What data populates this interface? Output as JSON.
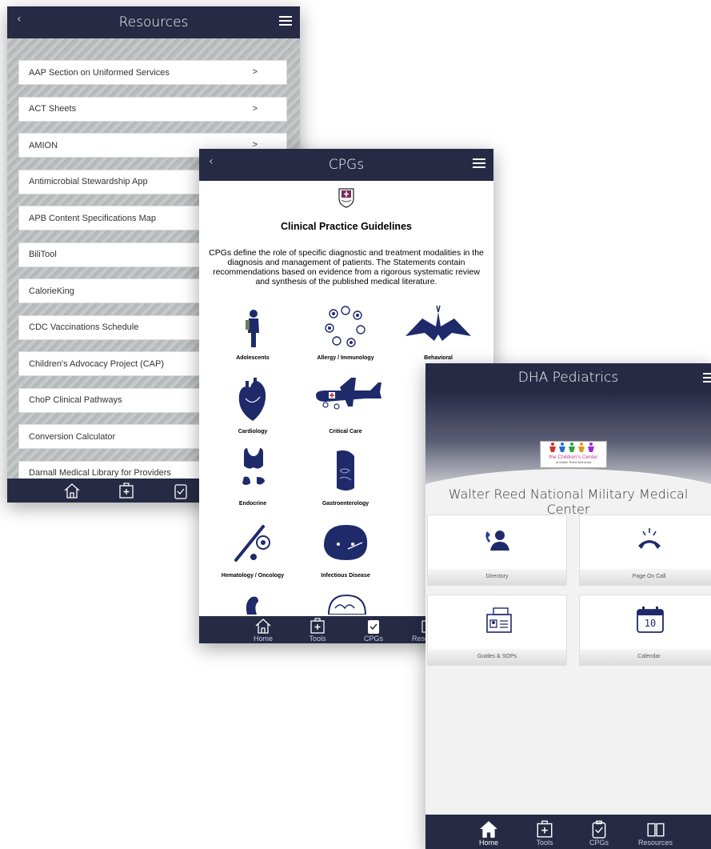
{
  "resources": {
    "title": "Resources",
    "back": "‹",
    "items": [
      {
        "label": "AAP Section on Uniformed Services",
        "chevron": ">"
      },
      {
        "label": "ACT Sheets",
        "chevron": ">"
      },
      {
        "label": "AMION",
        "chevron": ">"
      },
      {
        "label": "Antimicrobial Stewardship App"
      },
      {
        "label": "APB Content Specifications Map"
      },
      {
        "label": "BiliTool"
      },
      {
        "label": "CalorieKing"
      },
      {
        "label": "CDC Vaccinations Schedule"
      },
      {
        "label": "Children's Advocacy Project (CAP)"
      },
      {
        "label": "ChoP Clinical Pathways"
      },
      {
        "label": "Conversion Calculator"
      },
      {
        "label": "Darnall Medical Library for Providers"
      }
    ]
  },
  "cpgs": {
    "title": "CPGs",
    "back": "‹",
    "heading": "Clinical Practice Guidelines",
    "description": "CPGs define the role of specific diagnostic and treatment modalities in the diagnosis and management of patients. The Statements contain recommendations based on evidence from a rigorous systematic review and synthesis of the published medical literature.",
    "categories": [
      {
        "label": "Adolescents",
        "icon": "adolescent-icon"
      },
      {
        "label": "Allergy / Immunology",
        "icon": "allergy-icon"
      },
      {
        "label": "Behavioral",
        "icon": "behavioral-icon"
      },
      {
        "label": "Cardiology",
        "icon": "heart-icon"
      },
      {
        "label": "Critical Care",
        "icon": "airplane-icon"
      },
      {
        "label": "Endocrine",
        "icon": "thyroid-icon"
      },
      {
        "label": "Gastroenterology",
        "icon": "stomach-icon"
      },
      {
        "label": "Hematology / Oncology",
        "icon": "bone-icon"
      },
      {
        "label": "Infectious Disease",
        "icon": "sick-face-icon"
      }
    ],
    "tabs": [
      {
        "label": "Home"
      },
      {
        "label": "Tools"
      },
      {
        "label": "CPGs"
      },
      {
        "label": "Resources"
      }
    ]
  },
  "dha": {
    "title": "DHA Pediatrics",
    "logo_text_1": "the Children's Center",
    "logo_text_2": "at Walter Reed Bethesda",
    "center_name": "Walter Reed National Military Medical Center",
    "tiles": [
      {
        "label": "Directory",
        "icon": "phone-person-icon"
      },
      {
        "label": "Page On Call",
        "icon": "ringing-phone-icon"
      },
      {
        "label": "Guides & SOPs",
        "icon": "id-card-icon"
      },
      {
        "label": "Calendar",
        "icon": "calendar-icon",
        "day": "10"
      }
    ],
    "tabs": [
      {
        "label": "Home"
      },
      {
        "label": "Tools"
      },
      {
        "label": "CPGs"
      },
      {
        "label": "Resources"
      }
    ]
  },
  "colors": {
    "navy": "#262a45",
    "icon_blue": "#1f2a6b"
  }
}
